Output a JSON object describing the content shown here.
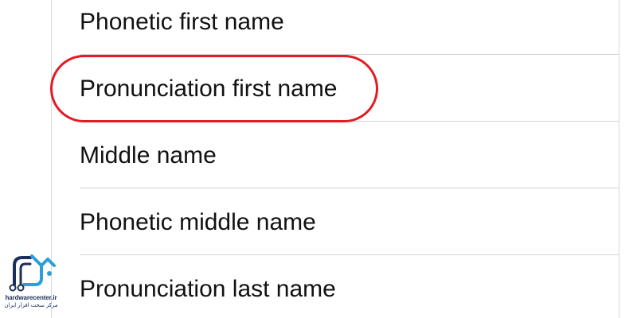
{
  "contact_fields": {
    "items": [
      {
        "label": "Phonetic first name"
      },
      {
        "label": "Pronunciation first name"
      },
      {
        "label": "Middle name"
      },
      {
        "label": "Phonetic middle name"
      },
      {
        "label": "Pronunciation last name"
      }
    ],
    "highlighted_index": 1,
    "highlight_color": "#e31b23"
  },
  "watermark": {
    "icon": "circuit-logo-icon",
    "brand": "hardwarecenter.ir",
    "tagline": "مرکز سخت افزار ایران",
    "color": "#1c2f5a",
    "accent": "#2a9fd8"
  }
}
